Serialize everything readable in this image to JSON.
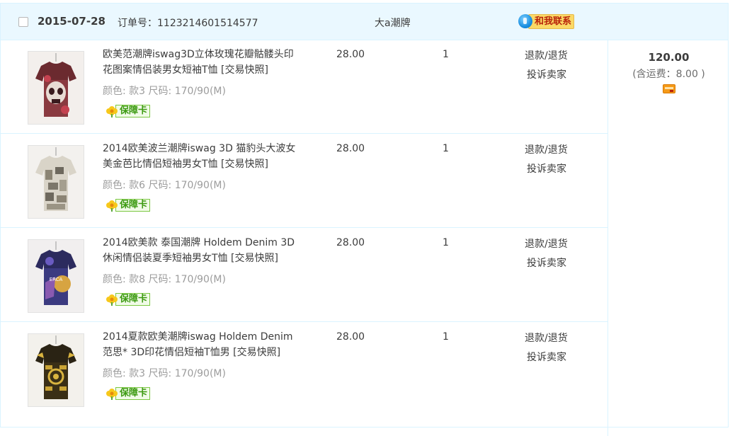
{
  "order": {
    "date": "2015-07-28",
    "order_no_label": "订单号：",
    "order_no": "1123214601514577",
    "shop_name": "大a潮牌",
    "contact_label": "和我联系",
    "total": "120.00",
    "shipping": "(含运费：8.00 )"
  },
  "items": [
    {
      "title": "欧美范潮牌iswag3D立体玫瑰花瓣骷髅头印花图案情侣装男女短袖T恤 [交易快照]",
      "specs": "颜色: 款3  尺码: 170/90(M)",
      "badge": "保障卡",
      "price": "28.00",
      "qty": "1",
      "refund": "退款/退货",
      "complain": "投诉卖家"
    },
    {
      "title": "2014欧美波兰潮牌iswag 3D 猫豹头大波女美金芭比情侣短袖男女T恤 [交易快照]",
      "specs": "颜色: 款6  尺码: 170/90(M)",
      "badge": "保障卡",
      "price": "28.00",
      "qty": "1",
      "refund": "退款/退货",
      "complain": "投诉卖家"
    },
    {
      "title": "2014欧美款 泰国潮牌 Holdem Denim 3D 休闲情侣装夏季短袖男女T恤 [交易快照]",
      "specs": "颜色: 款8  尺码: 170/90(M)",
      "badge": "保障卡",
      "price": "28.00",
      "qty": "1",
      "refund": "退款/退货",
      "complain": "投诉卖家"
    },
    {
      "title": "2014夏款欧美潮牌iswag Holdem Denim 范思* 3D印花情侣短袖T恤男 [交易快照]",
      "specs": "颜色: 款3  尺码: 170/90(M)",
      "badge": "保障卡",
      "price": "28.00",
      "qty": "1",
      "refund": "退款/退货",
      "complain": "投诉卖家"
    }
  ]
}
